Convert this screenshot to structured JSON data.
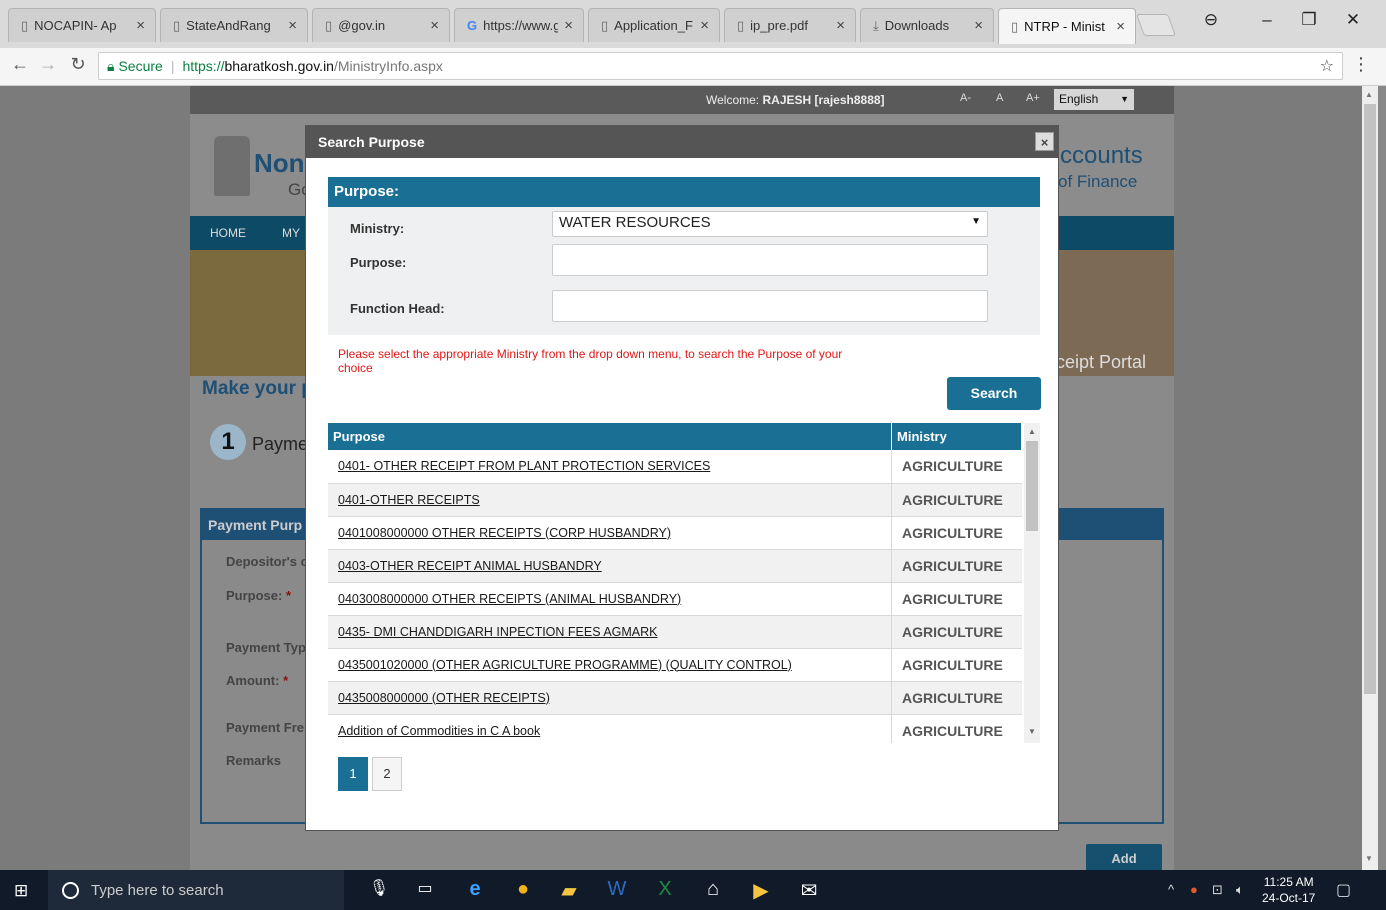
{
  "browser": {
    "tabs": [
      {
        "title": "NOCAPIN- Ap",
        "icon": "page-icon",
        "active": false
      },
      {
        "title": "StateAndRang",
        "icon": "page-icon",
        "active": false
      },
      {
        "title": "@gov.in",
        "icon": "page-icon",
        "active": false
      },
      {
        "title": "https://www.g",
        "icon": "google-icon",
        "active": false
      },
      {
        "title": "Application_F",
        "icon": "page-icon",
        "active": false
      },
      {
        "title": "ip_pre.pdf",
        "icon": "page-icon",
        "active": false
      },
      {
        "title": "Downloads",
        "icon": "download-icon",
        "active": false
      },
      {
        "title": "NTRP - Minist",
        "icon": "page-icon",
        "active": true
      }
    ],
    "secure_label": "Secure",
    "url_proto": "https://",
    "url_host": "bharatkosh.gov.in",
    "url_path": "/MinistryInfo.aspx"
  },
  "site": {
    "welcome_prefix": "Welcome:",
    "welcome_user": "RAJESH [rajesh8888]",
    "font_small": "A-",
    "font_normal": "A",
    "font_large": "A+",
    "language": "English",
    "title_left": "Non-",
    "title_left2": "Go",
    "title_right": "ccounts",
    "title_right2": "of Finance",
    "nav_home": "HOME",
    "nav_my": "MY",
    "portal_text": "ceipt Portal",
    "make_text": "Make your p",
    "step_number": "1",
    "step_text": "Payme",
    "panel_title": "Payment Purp",
    "labels": {
      "depositor": "Depositor's c",
      "purpose": "Purpose:",
      "payment_type": "Payment Typ",
      "amount": "Amount:",
      "payment_freq": "Payment Fre",
      "remarks": "Remarks"
    },
    "add_button": "Add"
  },
  "modal": {
    "title": "Search Purpose",
    "close": "×",
    "section_title": "Purpose:",
    "ministry_label": "Ministry:",
    "ministry_value": "WATER RESOURCES",
    "purpose_label": "Purpose:",
    "purpose_value": "",
    "function_head_label": "Function Head:",
    "function_head_value": "",
    "hint": "Please select the appropriate Ministry from the drop down menu, to search the Purpose of your choice",
    "search_button": "Search",
    "table": {
      "columns": [
        "Purpose",
        "Ministry"
      ],
      "rows": [
        {
          "purpose": "0401- OTHER RECEIPT FROM PLANT PROTECTION SERVICES",
          "ministry": "AGRICULTURE"
        },
        {
          "purpose": "0401-OTHER RECEIPTS",
          "ministry": "AGRICULTURE"
        },
        {
          "purpose": "0401008000000 OTHER RECEIPTS (CORP HUSBANDRY)",
          "ministry": "AGRICULTURE"
        },
        {
          "purpose": "0403-OTHER RECEIPT ANIMAL HUSBANDRY",
          "ministry": "AGRICULTURE"
        },
        {
          "purpose": "0403008000000 OTHER RECEIPTS (ANIMAL HUSBANDRY)",
          "ministry": "AGRICULTURE"
        },
        {
          "purpose": "0435- DMI CHANDDIGARH INPECTION FEES AGMARK",
          "ministry": "AGRICULTURE"
        },
        {
          "purpose": "0435001020000 (OTHER AGRICULTURE PROGRAMME) (QUALITY CONTROL)",
          "ministry": "AGRICULTURE"
        },
        {
          "purpose": "0435008000000 (OTHER RECEIPTS)",
          "ministry": "AGRICULTURE"
        },
        {
          "purpose": "Addition of Commodities in C A book",
          "ministry": "AGRICULTURE"
        }
      ]
    },
    "pages": [
      "1",
      "2"
    ],
    "current_page": "1"
  },
  "taskbar": {
    "search_placeholder": "Type here to search",
    "time": "11:25 AM",
    "date": "24-Oct-17"
  },
  "colors": {
    "accent": "#1a6f95",
    "hint": "#e01818",
    "taskbar": "#101a28"
  }
}
